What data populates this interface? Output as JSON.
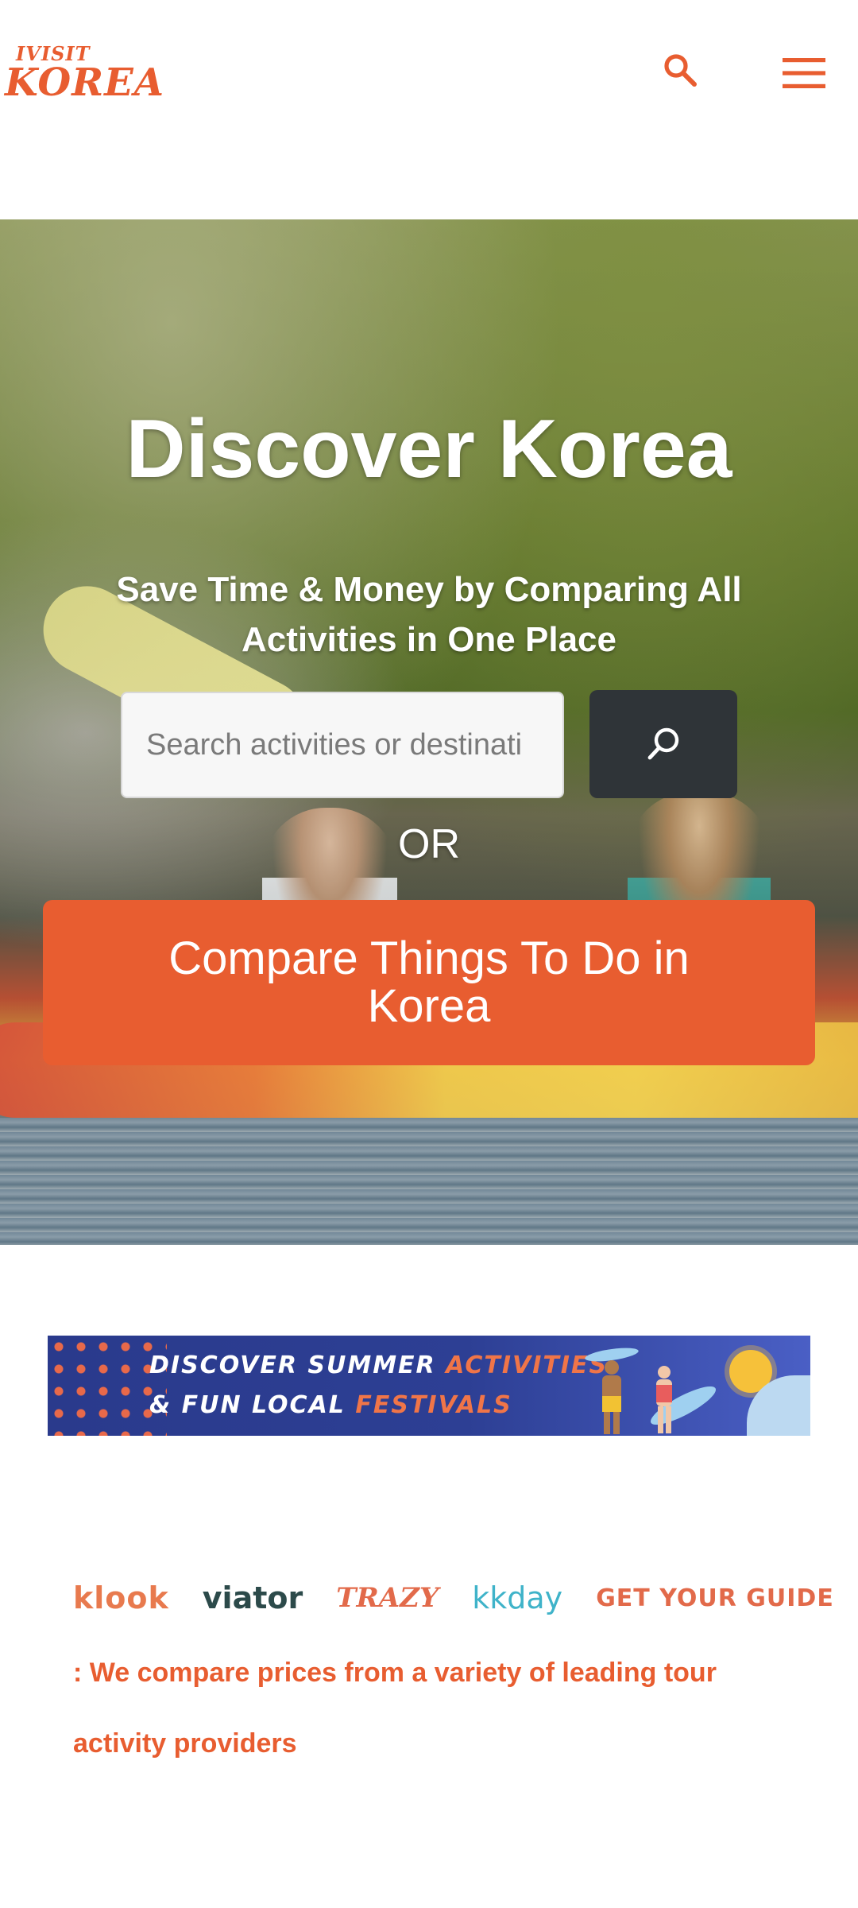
{
  "header": {
    "logo_top": "IVISIT",
    "logo_bottom": "KOREA",
    "search_icon": "search-icon",
    "menu_icon": "menu-icon",
    "accent_color": "#e85d30"
  },
  "hero": {
    "title": "Discover Korea",
    "subtitle": "Save Time & Money by Comparing All Activities in One Place",
    "search_placeholder": "Search activities or destinati",
    "search_button_icon": "search-icon",
    "or_text": "OR",
    "compare_button": "Compare Things To Do in Korea",
    "compare_button_color": "#e85d30",
    "search_button_color": "#2f3438"
  },
  "banner": {
    "line1_prefix": "DISCOVER SUMMER ",
    "line1_accent": "ACTIVITIES",
    "line2_prefix": "& FUN LOCAL ",
    "line2_accent": "FESTIVALS"
  },
  "providers": {
    "logos": [
      "klook",
      "viator",
      "TRAZY",
      "kkday",
      "GET YOUR GUIDE"
    ],
    "description": ": We compare prices from a variety of leading tour activity providers"
  }
}
